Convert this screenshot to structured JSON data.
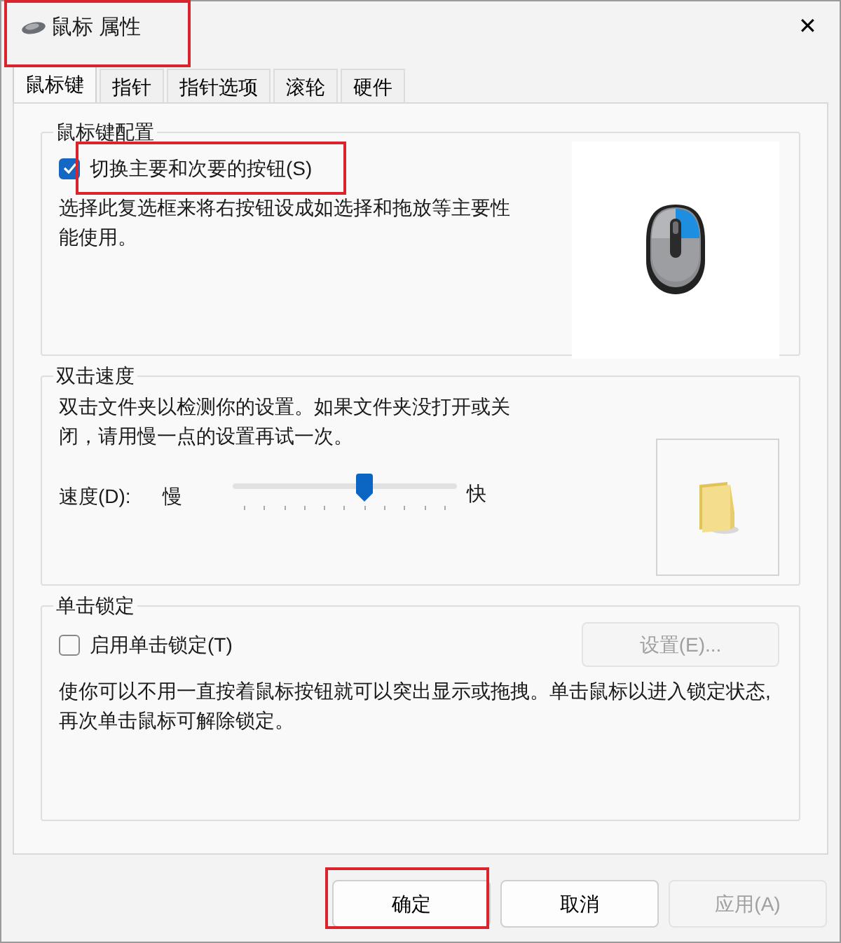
{
  "window": {
    "title": "鼠标 属性",
    "highlighted": true,
    "close": "✕"
  },
  "tabs": [
    {
      "label": "鼠标键",
      "selected": true
    },
    {
      "label": "指针",
      "selected": false
    },
    {
      "label": "指针选项",
      "selected": false
    },
    {
      "label": "滚轮",
      "selected": false
    },
    {
      "label": "硬件",
      "selected": false
    }
  ],
  "button_config": {
    "legend": "鼠标键配置",
    "checkbox": {
      "label": "切换主要和次要的按钮(S)",
      "checked": true,
      "highlighted": true
    },
    "description": "选择此复选框来将右按钮设成如选择和拖放等主要性能使用。",
    "swapped_highlight": true
  },
  "double_click": {
    "legend": "双击速度",
    "description": "双击文件夹以检测你的设置。如果文件夹没打开或关闭，请用慢一点的设置再试一次。",
    "speed_label": "速度(D):",
    "slow": "慢",
    "fast": "快",
    "level": 0.59
  },
  "click_lock": {
    "legend": "单击锁定",
    "checkbox": {
      "label": "启用单击锁定(T)",
      "checked": false,
      "highlighted": false
    },
    "settings_button": {
      "label": "设置(E)...",
      "disabled": true
    },
    "description": "使你可以不用一直按着鼠标按钮就可以突出显示或拖拽。单击鼠标以进入锁定状态,再次单击鼠标可解除锁定。"
  },
  "buttons": [
    {
      "label": "确定",
      "disabled": false,
      "highlighted": true
    },
    {
      "label": "取消",
      "disabled": false,
      "highlighted": false
    },
    {
      "label": "应用(A)",
      "disabled": true,
      "highlighted": false
    }
  ]
}
